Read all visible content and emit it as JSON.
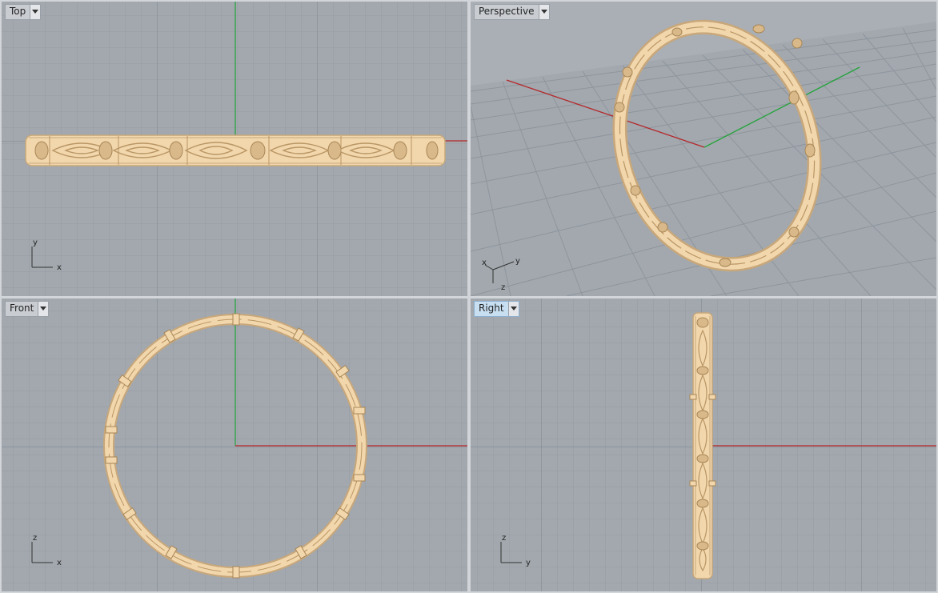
{
  "viewports": {
    "top": {
      "label": "Top",
      "axis_h": "x",
      "axis_v": "y"
    },
    "perspective": {
      "label": "Perspective",
      "axis_a": "x",
      "axis_b": "y",
      "axis_c": "z"
    },
    "front": {
      "label": "Front",
      "axis_h": "x",
      "axis_v": "z"
    },
    "right": {
      "label": "Right",
      "axis_h": "y",
      "axis_v": "z",
      "active": true
    }
  },
  "icons": {
    "viewport_menu": "dropdown-arrow-icon"
  },
  "colors": {
    "background": "#a2a8ae",
    "grid_minor": "#959ba2",
    "grid_major": "#7e858c",
    "x_axis": "#b5272a",
    "y_axis": "#23a33a",
    "model": "#f2d7ad",
    "model_shadow": "#c8a77a",
    "active_label": "#c8dff2"
  }
}
